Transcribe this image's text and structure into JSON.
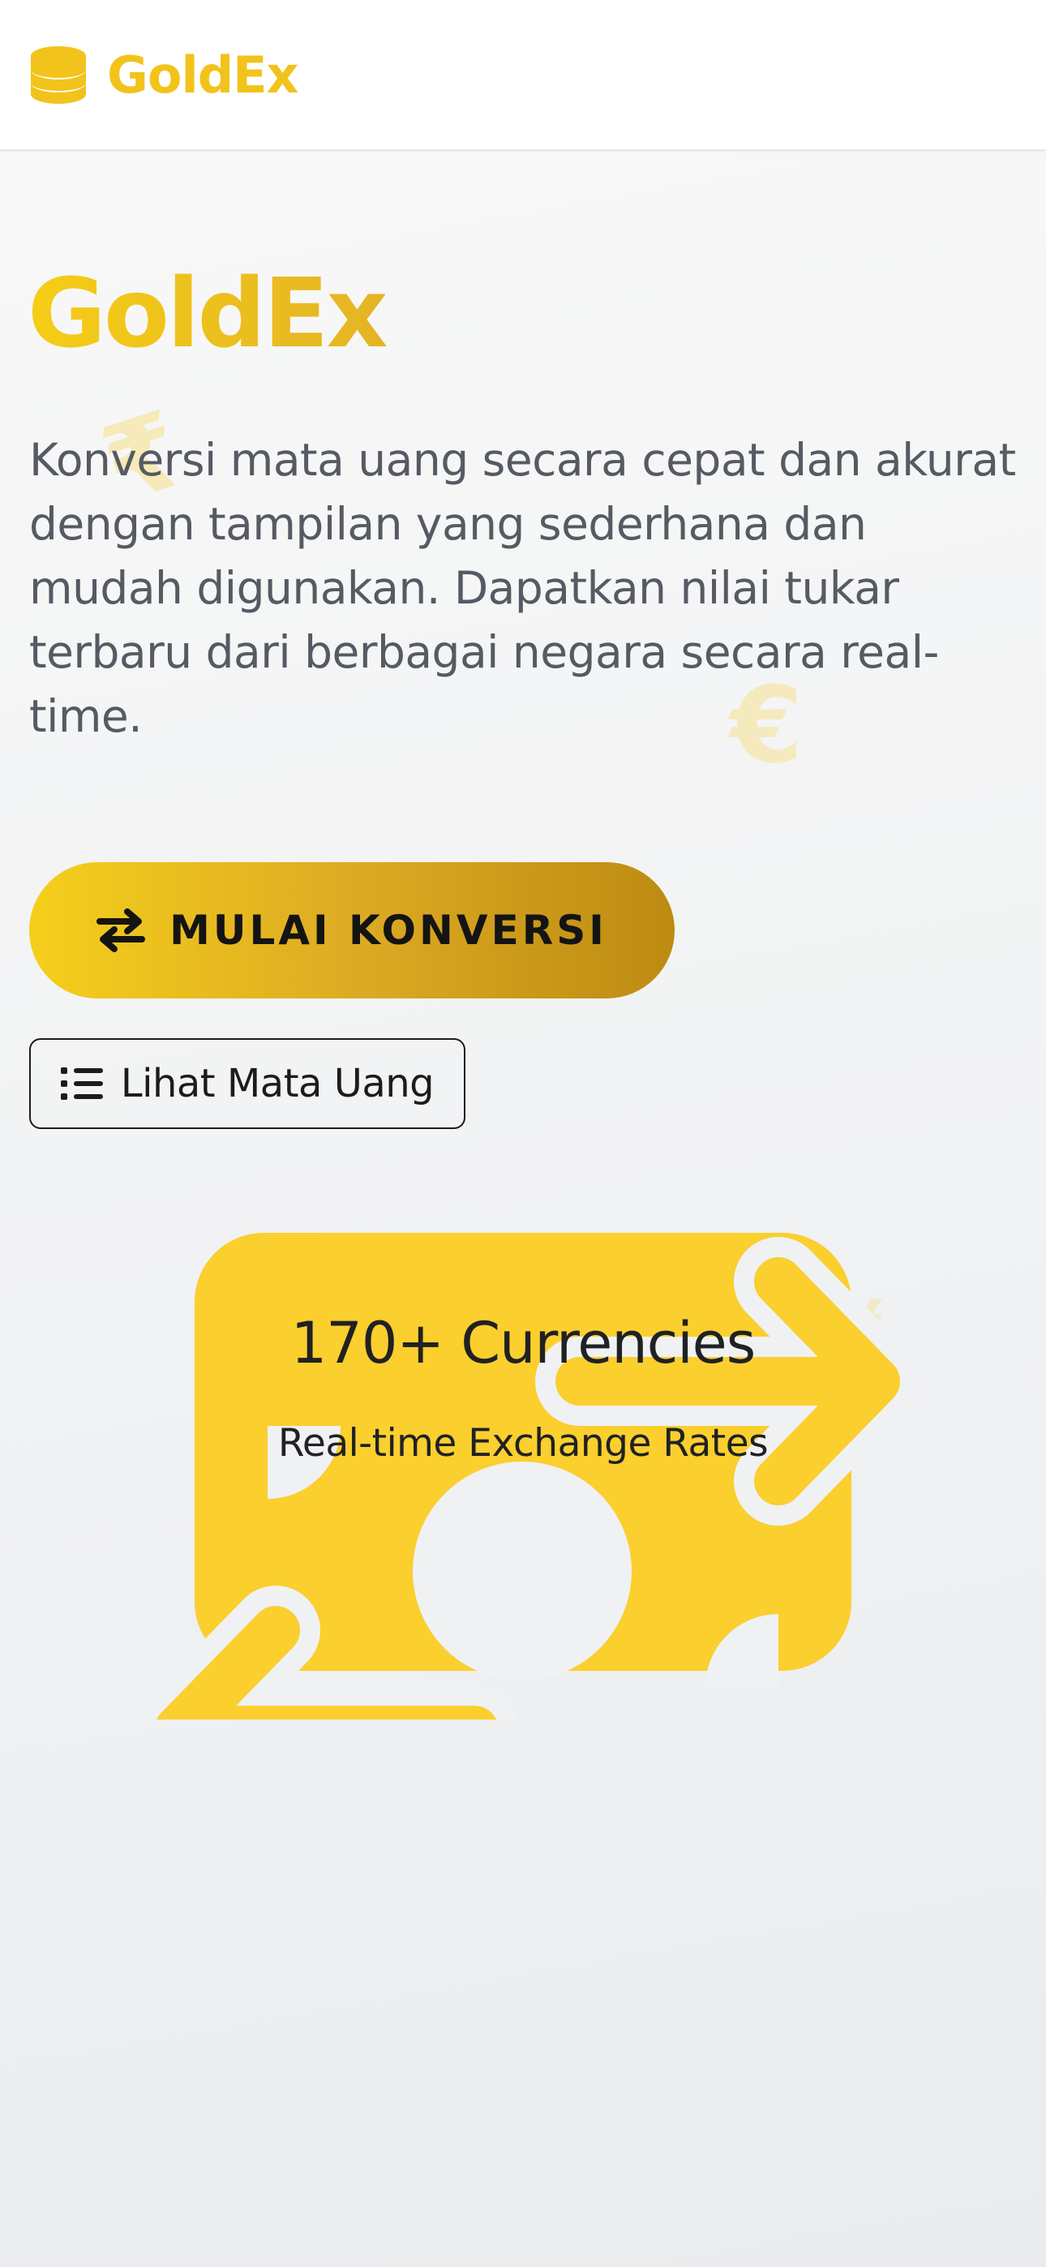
{
  "header": {
    "brand_name": "GoldEx",
    "logo_icon": "coins-icon"
  },
  "hero": {
    "title": "GoldEx",
    "description": "Konversi mata uang secara cepat dan akurat dengan tampilan yang sederhana dan mudah digunakan. Dapatkan nilai tukar terbaru dari berbagai negara secara real-time.",
    "primary_button": {
      "label": "MULAI KONVERSI",
      "icon": "exchange-arrows-icon"
    },
    "secondary_button": {
      "label": "Lihat Mata Uang",
      "icon": "list-icon"
    },
    "decorations": {
      "rupee": "₹",
      "euro": "€",
      "small_a": "¥",
      "small_b": "$"
    }
  },
  "stats": {
    "illustration_icon": "money-bill-transfer-icon",
    "title": "170+ Currencies",
    "subtitle": "Real-time Exchange Rates"
  },
  "colors": {
    "gold": "#F6CD16",
    "gold_dark": "#BD8B11",
    "illustration_gold": "#FACF2E",
    "text_gray": "#555A63",
    "text_dark": "#202124"
  }
}
